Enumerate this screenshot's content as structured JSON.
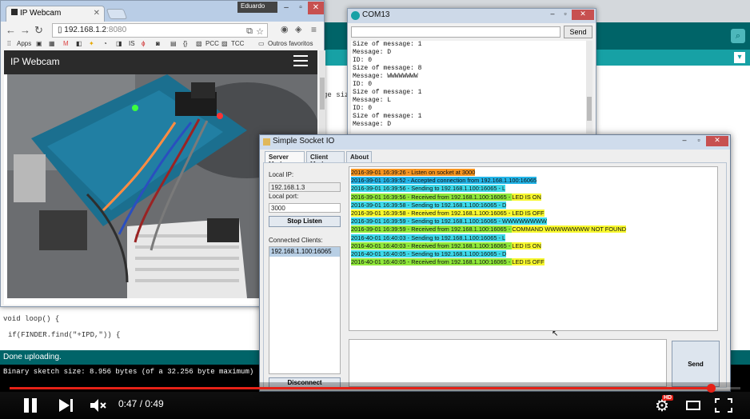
{
  "chrome": {
    "user": "Eduardo",
    "tab_title": "IP Webcam",
    "url_host": "192.168.1.2",
    "url_port": ":8080",
    "bookmarks": [
      "Apps",
      "IS",
      "PCC",
      "TCC",
      "Outros favoritos"
    ],
    "page_header": "IP Webcam"
  },
  "arduino": {
    "code_fragment": "ge siz",
    "code_loop": "void loop() {",
    "code_if": "if(FINDER.find(\"+IPD,\")) {",
    "status": "Done uploading.",
    "console": "Binary sketch size: 8.956 bytes (of a 32.256 byte maximum)"
  },
  "com": {
    "title": "COM13",
    "send_label": "Send",
    "lines": [
      "Size of message: 1",
      "Message: D",
      "ID: 0",
      "Size of message: 8",
      "Message: WWWWWWWW",
      "ID: 0",
      "Size of message: 1",
      "Message: L",
      "ID: 0",
      "Size of message: 1",
      "Message: D"
    ]
  },
  "ssio": {
    "title": "Simple Socket IO",
    "tabs": [
      "Server Mode",
      "Client Mode",
      "About"
    ],
    "local_ip_label": "Local IP:",
    "local_ip": "192.168.1.3",
    "local_port_label": "Local port:",
    "local_port": "3000",
    "stop_label": "Stop Listen",
    "clients_label": "Connected Clients:",
    "client": "192.168.1.100:16065",
    "disconnect_label": "Disconnect",
    "send_label": "Send",
    "log": [
      {
        "parts": [
          {
            "t": "2016-39-01 16:39:26 - Listen on socket at 3000",
            "c": "orange"
          }
        ]
      },
      {
        "parts": [
          {
            "t": "2016-39-01 16:39:52 - Accepted connection from 192.168.1.100:16065",
            "c": "blue"
          }
        ]
      },
      {
        "parts": [
          {
            "t": "2016-39-01 16:39:56 - Sending to 192.168.1.100:16065 - L",
            "c": "cyan"
          }
        ]
      },
      {
        "parts": [
          {
            "t": "2016-39-01 16:39:56 - Received from 192.168.1.100:16065 - ",
            "c": "green"
          },
          {
            "t": "LED IS ON",
            "c": "yellow"
          }
        ]
      },
      {
        "parts": [
          {
            "t": "2016-39-01 16:39:58 - Sending to 192.168.1.100:16065 - D",
            "c": "cyan"
          }
        ]
      },
      {
        "parts": [
          {
            "t": "2016-39-01 16:39:58 - Received from 192.168.1.100:16065 - LED IS OFF",
            "c": "yellow"
          }
        ]
      },
      {
        "parts": [
          {
            "t": "2016-39-01 16:39:59 - Sending to 192.168.1.100:16065 - WWWWWWWW",
            "c": "cyan"
          }
        ]
      },
      {
        "parts": [
          {
            "t": "2016-39-01 16:39:59 - Received from 192.168.1.100:16065 - ",
            "c": "green"
          },
          {
            "t": "COMMAND WWWWWWWW NOT FOUND",
            "c": "yellow"
          }
        ]
      },
      {
        "parts": [
          {
            "t": "2016-40-01 16:40:03 - Sending to 192.168.1.100:16065 - L",
            "c": "cyan"
          }
        ]
      },
      {
        "parts": [
          {
            "t": "2016-40-01 16:40:03 - Received from 192.168.1.100:16065 - ",
            "c": "green"
          },
          {
            "t": "LED IS ON",
            "c": "yellow"
          }
        ]
      },
      {
        "parts": [
          {
            "t": "2016-40-01 16:40:05 - Sending to 192.168.1.100:16065 - D",
            "c": "cyan"
          }
        ]
      },
      {
        "parts": [
          {
            "t": "2016-40-01 16:40:05 - Received from 192.168.1.100:16065 - ",
            "c": "green"
          },
          {
            "t": "LED IS OFF",
            "c": "yellow"
          }
        ]
      }
    ]
  },
  "player": {
    "time_current": "0:47",
    "time_total": "0:49",
    "progress_fraction": 0.959,
    "hd_badge": "HD",
    "accent": "#e52117"
  },
  "colors": {
    "arduino_teal": "#17a1a5",
    "arduino_dark": "#006468",
    "log_orange": "#f79520",
    "log_blue": "#23b5e8",
    "log_cyan": "#3cd9ea",
    "log_yellow": "#f7f72d",
    "log_green": "#8fe83a"
  }
}
